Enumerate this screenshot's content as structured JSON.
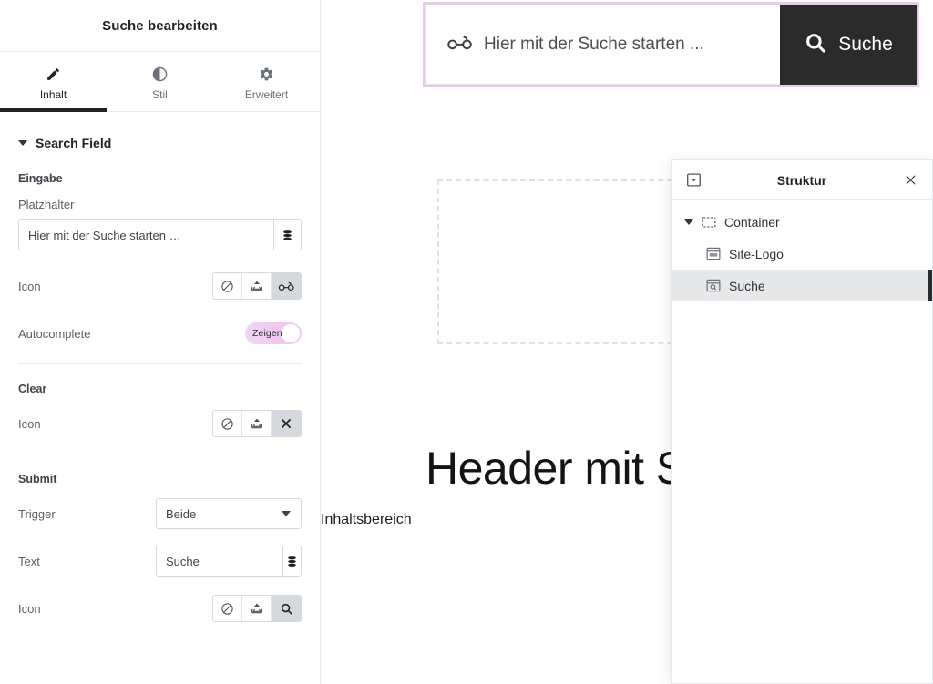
{
  "editor_panel": {
    "header": {
      "title": "Suche bearbeiten"
    },
    "tabs": [
      {
        "label": "Inhalt",
        "icon": "pencil-icon",
        "active": true
      },
      {
        "label": "Stil",
        "icon": "contrast-icon",
        "active": false
      },
      {
        "label": "Erweitert",
        "icon": "gear-icon",
        "active": false
      }
    ],
    "section": {
      "title": "Search Field"
    },
    "groups": {
      "eingabe": {
        "label": "Eingabe",
        "placeholder_field": {
          "label": "Platzhalter",
          "value": "Hier mit der Suche starten …",
          "placeholder": "Hier mit der Suche starten …",
          "dynamic_icon": "database-icon"
        },
        "icon_row": {
          "label": "Icon",
          "options": [
            "none-icon",
            "upload-icon",
            "glasses-icon"
          ],
          "selected": "glasses-icon"
        },
        "autocomplete": {
          "label": "Autocomplete",
          "state_label": "Zeigen",
          "on": true
        }
      },
      "clear": {
        "label": "Clear",
        "icon_row": {
          "label": "Icon",
          "options": [
            "none-icon",
            "upload-icon",
            "close-x-icon"
          ],
          "selected": "close-x-icon"
        }
      },
      "submit": {
        "label": "Submit",
        "trigger": {
          "label": "Trigger",
          "value": "Beide"
        },
        "text": {
          "label": "Text",
          "value": "Suche",
          "dynamic_icon": "database-icon"
        },
        "icon_row": {
          "label": "Icon",
          "options": [
            "none-icon",
            "upload-icon",
            "search-icon"
          ],
          "selected": "search-icon"
        }
      }
    }
  },
  "canvas": {
    "search_widget": {
      "placeholder": "Hier mit der Suche starten ...",
      "input_icon": "glasses-icon",
      "submit_label": "Suche",
      "submit_icon": "search-icon",
      "selection_color": "#e7c9ec",
      "submit_bg": "#2b2b2b"
    },
    "heading": "Header mit S",
    "subtext": "Inhaltsbereich"
  },
  "navigator": {
    "title": "Struktur",
    "dock_icon": "dock-down-icon",
    "close_icon": "close-icon",
    "tree": [
      {
        "label": "Container",
        "icon": "container-icon",
        "depth": 1,
        "expanded": true,
        "selected": false
      },
      {
        "label": "Site-Logo",
        "icon": "site-logo-icon",
        "depth": 2,
        "expanded": false,
        "selected": false
      },
      {
        "label": "Suche",
        "icon": "search-widget-icon",
        "depth": 2,
        "expanded": false,
        "selected": true
      }
    ]
  }
}
